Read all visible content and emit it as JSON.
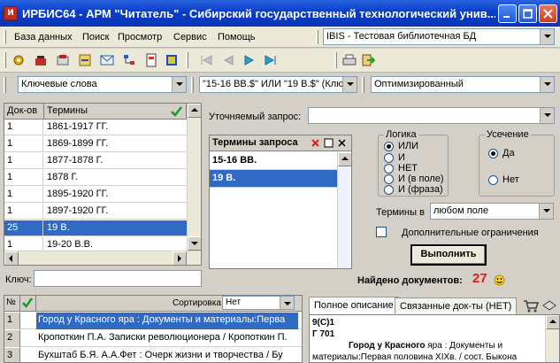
{
  "window": {
    "title": "ИРБИС64 - АРМ \"Читатель\" - Сибирский государственный технологический унив..."
  },
  "menu": {
    "items": [
      "База данных",
      "Поиск",
      "Просмотр",
      "Сервис",
      "Помощь"
    ],
    "database": "IBIS - Тестовая библиотечная БД"
  },
  "search": {
    "mode": "Ключевые слова",
    "expression": "\"15-16 ВВ.$\" ИЛИ \"19 В.$\" (Клю",
    "sort": "Оптимизированный"
  },
  "terms": {
    "col_count": "Док-ов",
    "col_terms": "Термины",
    "rows": [
      {
        "count": "1",
        "term": "1861-1917 ГГ."
      },
      {
        "count": "1",
        "term": "1869-1899 ГГ."
      },
      {
        "count": "1",
        "term": "1877-1878 Г."
      },
      {
        "count": "1",
        "term": "1878 Г."
      },
      {
        "count": "1",
        "term": "1895-1920 ГГ."
      },
      {
        "count": "1",
        "term": "1897-1920 ГГ."
      },
      {
        "count": "25",
        "term": "19 В."
      },
      {
        "count": "1",
        "term": "19-20 В.В."
      }
    ],
    "key_label": "Ключ:",
    "key_value": ""
  },
  "refine": {
    "label": "Уточняемый запрос:",
    "value": ""
  },
  "query_terms": {
    "header": "Термины запроса",
    "rows": [
      "15-16 ВВ.",
      "19 В."
    ]
  },
  "logic": {
    "title": "Логика",
    "options": [
      "ИЛИ",
      "И",
      "НЕТ",
      "И (в поле)",
      "И (фраза)"
    ],
    "selected": "ИЛИ"
  },
  "truncation": {
    "title": "Усечение",
    "options": [
      "Да",
      "Нет"
    ],
    "selected": "Да"
  },
  "terms_in": {
    "label": "Термины в",
    "value": "любом поле"
  },
  "extra": {
    "label": "Дополнительные ограничения"
  },
  "execute": {
    "label": "Выполнить"
  },
  "found": {
    "label": "Найдено документов:",
    "count": "27"
  },
  "results": {
    "col_no": "№",
    "sort_label": "Сортировка",
    "sort_value": "Нет",
    "rows": [
      {
        "n": "1",
        "text": "Город у Красного яра : Документы и материалы:Перва"
      },
      {
        "n": "2",
        "text": "Кропоткин П.А. Записки революционера / Кропоткин П."
      },
      {
        "n": "3",
        "text": "Бухштаб Б.Я. А.А.Фет : Очерк жизни и творчества / Бу"
      }
    ]
  },
  "tabs": {
    "full": "Полное описание",
    "linked": "Связанные док-ты (НЕТ)"
  },
  "description": {
    "line1": "9(С)1",
    "line2": "Г 701",
    "line3_bold": "Город у Красного",
    "line3_rest": " яра : Документы и",
    "line4": "материалы:Первая половина XIXв. / сост. Быкона"
  },
  "colors": {
    "title_blue": "#0a3cc8",
    "selection": "#316ac5",
    "found_red": "#e01b1b"
  }
}
